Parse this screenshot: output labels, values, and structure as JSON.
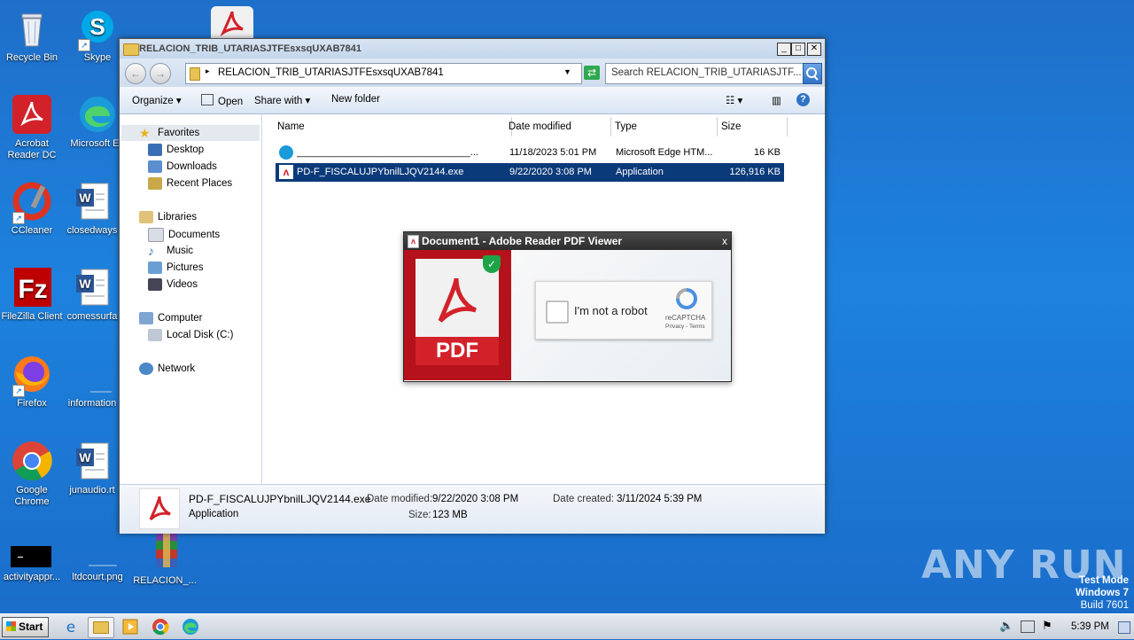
{
  "desktop": {
    "icons": [
      {
        "label": "Recycle Bin"
      },
      {
        "label": "Skype"
      },
      {
        "label": "Acrobat Reader DC"
      },
      {
        "label": "Microsoft Ed"
      },
      {
        "label": "CCleaner"
      },
      {
        "label": "closedways"
      },
      {
        "label": "FileZilla Client"
      },
      {
        "label": "comessurfa"
      },
      {
        "label": "Firefox"
      },
      {
        "label": "information"
      },
      {
        "label": "Google Chrome"
      },
      {
        "label": "junaudio.rt"
      },
      {
        "label": "activityappr..."
      },
      {
        "label": "ltdcourt.png"
      },
      {
        "label": "RELACION_..."
      }
    ],
    "watermark": {
      "brand": "ANY RUN",
      "line1": "Test Mode",
      "line2": "Windows 7",
      "line3": "Build 7601"
    }
  },
  "explorer": {
    "title": "RELACION_TRIB_UTARIASJTFEsxsqUXAB7841",
    "address": "RELACION_TRIB_UTARIASJTFEsxsqUXAB7841",
    "search_placeholder": "Search RELACION_TRIB_UTARIASJTF...",
    "toolbar": {
      "organize": "Organize",
      "open": "Open",
      "share": "Share with",
      "new_folder": "New folder"
    },
    "nav": {
      "favorites": "Favorites",
      "desktop": "Desktop",
      "downloads": "Downloads",
      "recent": "Recent Places",
      "libraries": "Libraries",
      "documents": "Documents",
      "music": "Music",
      "pictures": "Pictures",
      "videos": "Videos",
      "computer": "Computer",
      "local_disk": "Local Disk (C:)",
      "network": "Network"
    },
    "columns": {
      "name": "Name",
      "date": "Date modified",
      "type": "Type",
      "size": "Size"
    },
    "files": [
      {
        "name": "________________________________...",
        "date": "11/18/2023 5:01 PM",
        "type": "Microsoft Edge HTM...",
        "size": "16 KB"
      },
      {
        "name": "PD-F_FISCALUJPYbnilLJQV2144.exe",
        "date": "9/22/2020 3:08 PM",
        "type": "Application",
        "size": "126,916 KB"
      }
    ],
    "details": {
      "name": "PD-F_FISCALUJPYbnilLJQV2144.exe",
      "kind": "Application",
      "modified_label": "Date modified:",
      "modified": "9/22/2020 3:08 PM",
      "size_label": "Size:",
      "size": "123 MB",
      "created_label": "Date created:",
      "created": "3/11/2024 5:39 PM"
    }
  },
  "popup": {
    "title": "Document1 - Adobe Reader PDF Viewer",
    "close": "x",
    "pdf_label": "PDF",
    "captcha_text": "I'm not a robot",
    "captcha_brand": "reCAPTCHA",
    "captcha_links": "Privacy - Terms"
  },
  "taskbar": {
    "start": "Start",
    "time": "5:39 PM"
  }
}
